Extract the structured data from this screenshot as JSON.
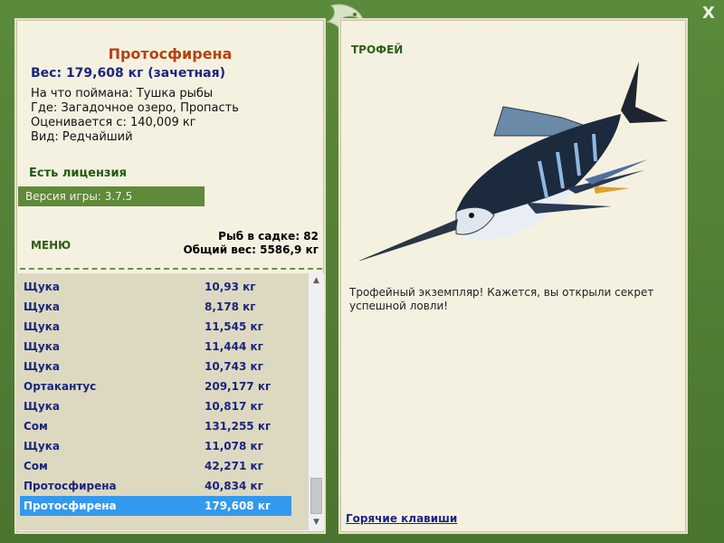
{
  "fish": {
    "name": "Протосфирена",
    "weight": "Вес: 179,608 кг (зачетная)",
    "caught_with": "На что поймана: Тушка рыбы",
    "location": "Где: Загадочное озеро, Пропасть",
    "valued_from": "Оценивается с: 140,009 кг",
    "rarity": "Вид: Редчайший"
  },
  "license": "Есть лицензия",
  "version": "Версия игры: 3.7.5",
  "menu_label": "МЕНЮ",
  "creel": {
    "count": "Рыб в садке: 82",
    "total_weight": "Общий вес: 5586,9 кг"
  },
  "catch_list": [
    {
      "name": "Щука",
      "weight": "10,93 кг"
    },
    {
      "name": "Щука",
      "weight": "8,178 кг"
    },
    {
      "name": "Щука",
      "weight": "11,545 кг"
    },
    {
      "name": "Щука",
      "weight": "11,444 кг"
    },
    {
      "name": "Щука",
      "weight": "10,743 кг"
    },
    {
      "name": "Ортакантус",
      "weight": "209,177 кг"
    },
    {
      "name": "Щука",
      "weight": "10,817 кг"
    },
    {
      "name": "Сом",
      "weight": "131,255 кг"
    },
    {
      "name": "Щука",
      "weight": "11,078 кг"
    },
    {
      "name": "Сом",
      "weight": "42,271 кг"
    },
    {
      "name": "Протосфирена",
      "weight": "40,834 кг"
    },
    {
      "name": "Протосфирена",
      "weight": "179,608 кг"
    }
  ],
  "selected_index": 11,
  "trophy": {
    "label": "ТРОФЕЙ",
    "description": "Трофейный экземпляр! Кажется, вы открыли секрет успешной ловли!"
  },
  "hotkeys_label": "Горячие клавиши",
  "close_label": "X",
  "icons": {
    "close": "close-icon",
    "logo": "fish-logo-icon",
    "scroll_up": "chevron-up-icon",
    "scroll_down": "chevron-down-icon"
  },
  "colors": {
    "frame": "#4f7a34",
    "panel": "#f5f1e1",
    "fish_name": "#b7410e",
    "list_text": "#1a2580",
    "selection": "#3399ee",
    "version_bar": "#5e8a3a"
  }
}
